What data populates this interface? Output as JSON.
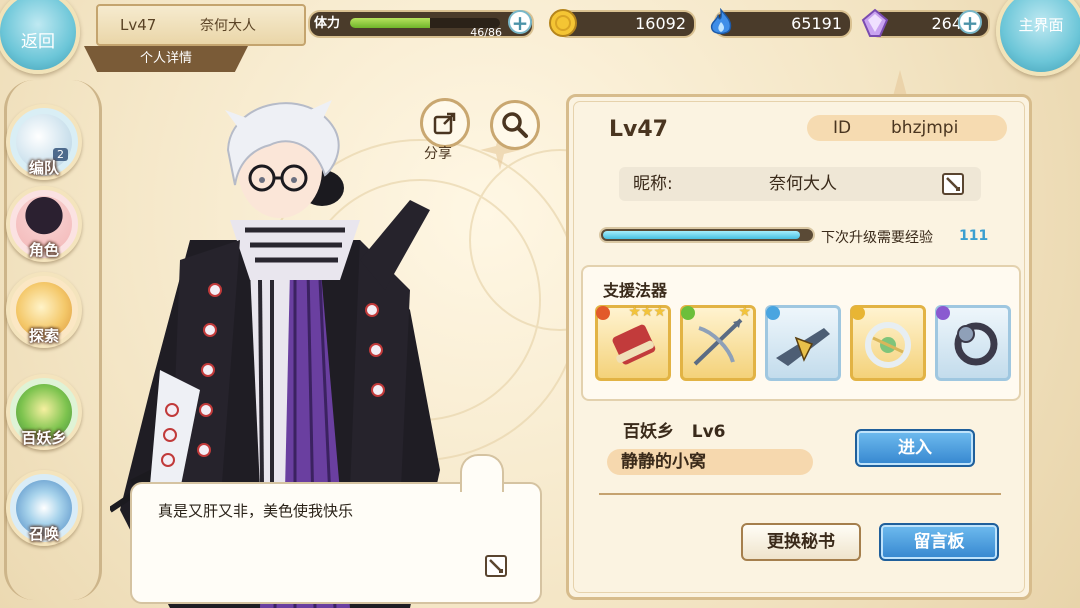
{
  "topbar": {
    "back_label": "返回",
    "home_label": "主界面",
    "player_level": "Lv47",
    "player_name": "奈何大人",
    "detail_tab": "个人详情",
    "stamina_label": "体力",
    "stamina_value": "46/86",
    "stamina_fraction": 0.535,
    "gold": "16092",
    "soul": "65191",
    "crystal": "264",
    "plus_label": "+"
  },
  "sidebar": {
    "items": [
      {
        "label": "编队",
        "badge": "2"
      },
      {
        "label": "角色"
      },
      {
        "label": "探索"
      },
      {
        "label": "百妖乡"
      },
      {
        "label": "召唤"
      }
    ]
  },
  "character": {
    "share_label": "分享",
    "speech": "真是又肝又非，美色使我快乐"
  },
  "profile": {
    "level": "Lv47",
    "id_label": "ID",
    "id_value": "bhzjmpi",
    "nickname_label": "昵称:",
    "nickname_value": "奈何大人",
    "exp_label": "下次升级需要经验",
    "exp_value": "111",
    "exp_fraction": 0.95,
    "support_title": "支援法器",
    "support_items": [
      {
        "name": "scroll-artifact-icon",
        "stars": "★★★",
        "frame": "#e2b344",
        "elem": "#e25a2a"
      },
      {
        "name": "crossbow-artifact-icon",
        "stars": "★",
        "frame": "#e2b344",
        "elem": "#6cbf3b"
      },
      {
        "name": "blade-artifact-icon",
        "stars": "",
        "frame": "#9fc7e0",
        "elem": "#4aa5e0"
      },
      {
        "name": "wreath-artifact-icon",
        "stars": "",
        "frame": "#e2b344",
        "elem": "#e8b534"
      },
      {
        "name": "ring-artifact-icon",
        "stars": "",
        "frame": "#9fc7e0",
        "elem": "#8a5ad0"
      }
    ],
    "village_label": "百妖乡   Lv6",
    "village_name": "静静的小窝",
    "enter_button": "进入",
    "change_secretary_button": "更换秘书",
    "message_board_button": "留言板"
  }
}
